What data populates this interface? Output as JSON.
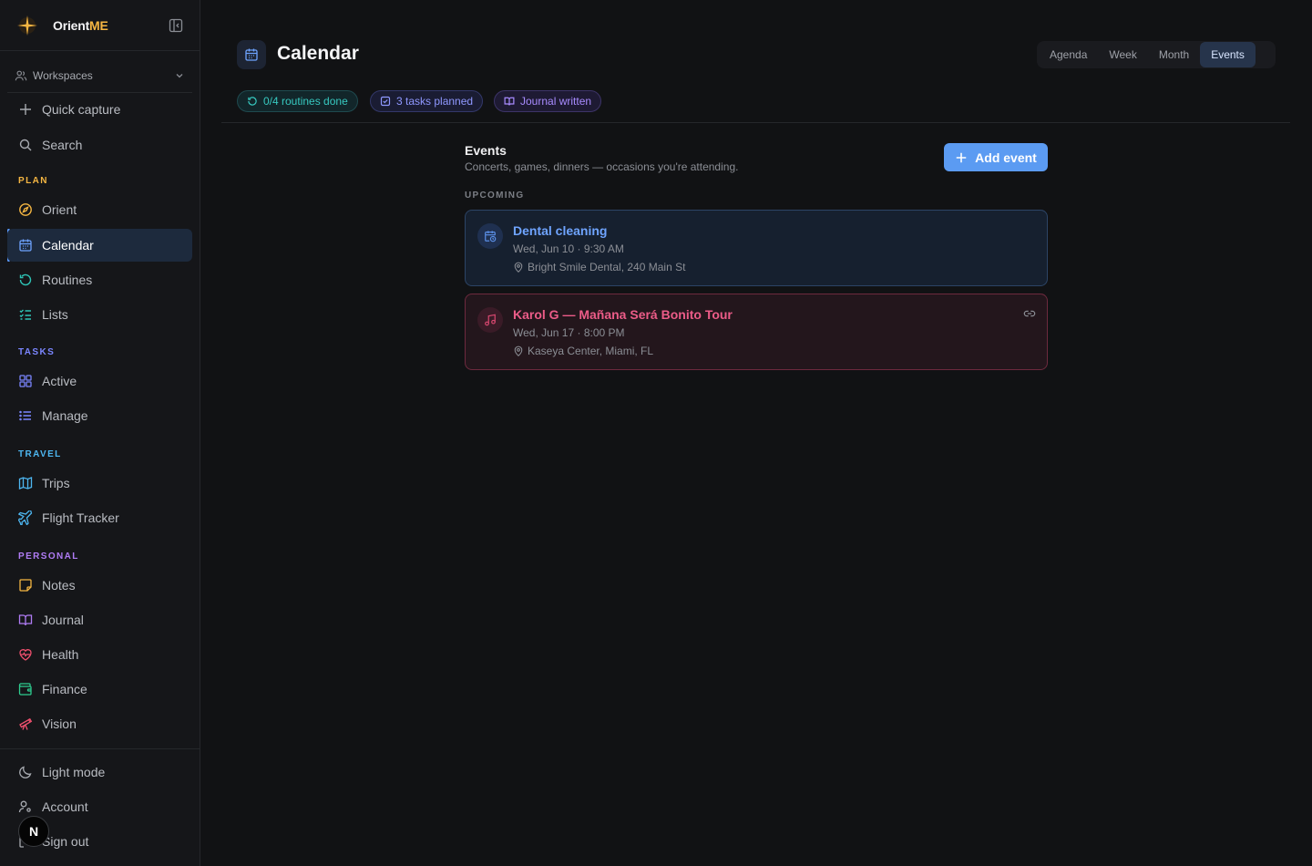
{
  "app": {
    "name_main": "Orient",
    "name_accent": "ME"
  },
  "sidebar": {
    "workspaces_label": "Workspaces",
    "quick_capture": "Quick capture",
    "search": "Search",
    "sections": {
      "plan": "PLAN",
      "tasks": "TASKS",
      "travel": "TRAVEL",
      "personal": "PERSONAL"
    },
    "items": {
      "orient": "Orient",
      "calendar": "Calendar",
      "routines": "Routines",
      "lists": "Lists",
      "active": "Active",
      "manage": "Manage",
      "trips": "Trips",
      "flight_tracker": "Flight Tracker",
      "notes": "Notes",
      "journal": "Journal",
      "health": "Health",
      "finance": "Finance",
      "vision": "Vision"
    },
    "footer": {
      "light_mode": "Light mode",
      "account": "Account",
      "sign_out": "Sign out"
    },
    "avatar_initial": "N",
    "colors": {
      "plan": "#f5b642",
      "tasks": "#7b86ff",
      "travel": "#4db6f0",
      "personal": "#b07cf5"
    }
  },
  "header": {
    "title": "Calendar",
    "views": [
      "Agenda",
      "Week",
      "Month",
      "Events"
    ],
    "active_view": "Events"
  },
  "chips": {
    "routines": "0/4 routines done",
    "tasks": "3 tasks planned",
    "journal": "Journal written"
  },
  "events": {
    "title": "Events",
    "subtitle": "Concerts, games, dinners — occasions you're attending.",
    "add_button": "Add event",
    "upcoming_label": "UPCOMING",
    "items": [
      {
        "title": "Dental cleaning",
        "time": "Wed, Jun 10 · 9:30 AM",
        "location": "Bright Smile Dental, 240 Main St",
        "icon": "calendar-clock-icon",
        "color": "#6fa4ff"
      },
      {
        "title": "Karol G — Mañana Será Bonito Tour",
        "time": "Wed, Jun 17 · 8:00 PM",
        "location": "Kaseya Center, Miami, FL",
        "icon": "music-note-icon",
        "color": "#ec5c88"
      }
    ]
  }
}
